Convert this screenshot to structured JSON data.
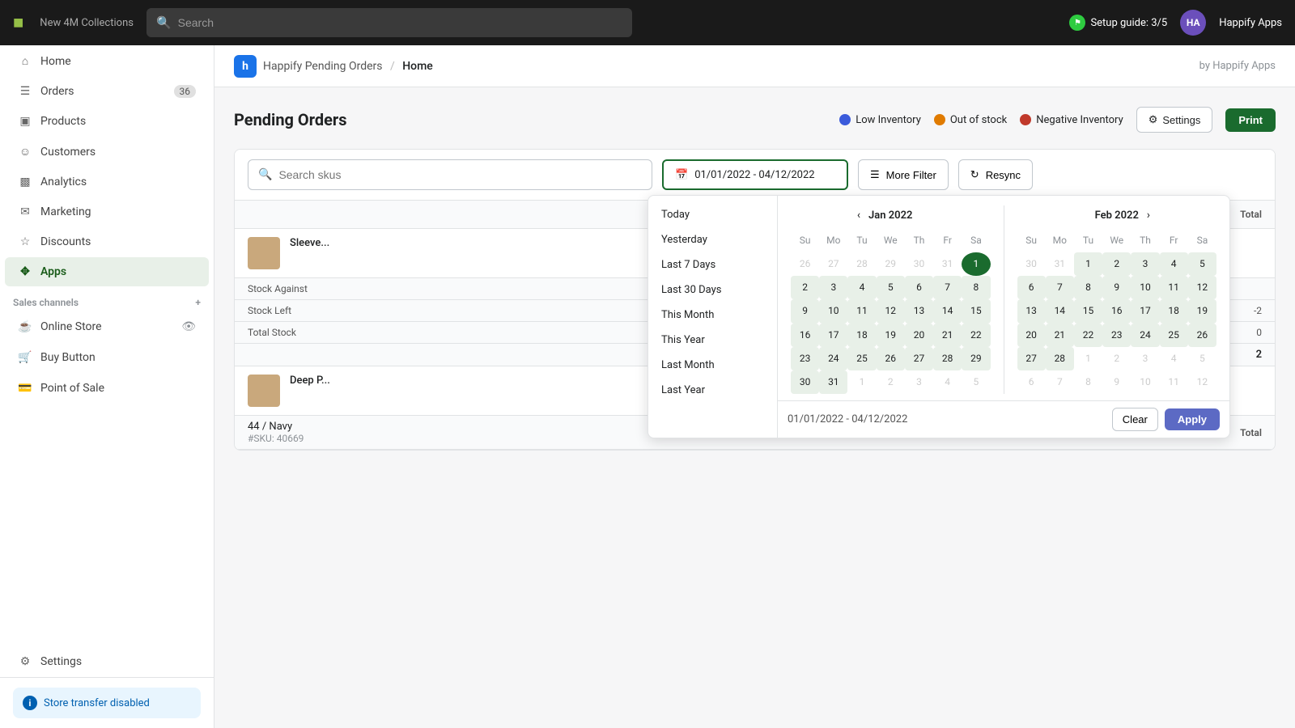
{
  "topBar": {
    "logoText": "S",
    "storeName": "New 4M Collections",
    "searchPlaceholder": "Search",
    "setupGuide": "Setup guide: 3/5",
    "userName": "Happify Apps",
    "userInitials": "HA"
  },
  "sidebar": {
    "navItems": [
      {
        "id": "home",
        "label": "Home",
        "icon": "🏠",
        "badge": null,
        "active": false
      },
      {
        "id": "orders",
        "label": "Orders",
        "icon": "📋",
        "badge": "36",
        "active": false
      },
      {
        "id": "products",
        "label": "Products",
        "icon": "📦",
        "badge": null,
        "active": false
      },
      {
        "id": "customers",
        "label": "Customers",
        "icon": "👤",
        "badge": null,
        "active": false
      },
      {
        "id": "analytics",
        "label": "Analytics",
        "icon": "📊",
        "badge": null,
        "active": false
      },
      {
        "id": "marketing",
        "label": "Marketing",
        "icon": "📣",
        "badge": null,
        "active": false
      },
      {
        "id": "discounts",
        "label": "Discounts",
        "icon": "🏷️",
        "badge": null,
        "active": false
      },
      {
        "id": "apps",
        "label": "Apps",
        "icon": "⊞",
        "badge": null,
        "active": true
      }
    ],
    "salesChannelsLabel": "Sales channels",
    "salesChannels": [
      {
        "id": "online-store",
        "label": "Online Store",
        "icon": "🏪"
      },
      {
        "id": "buy-button",
        "label": "Buy Button",
        "icon": "🛍️"
      },
      {
        "id": "point-of-sale",
        "label": "Point of Sale",
        "icon": "💳"
      }
    ],
    "settingsLabel": "Settings",
    "storeTransfer": "Store transfer disabled"
  },
  "appHeader": {
    "logoText": "h",
    "appName": "Happify Pending Orders",
    "separator": "/",
    "currentPage": "Home",
    "byLabel": "by Happify Apps"
  },
  "pageTitle": "Pending Orders",
  "legend": [
    {
      "id": "low-inventory",
      "label": "Low Inventory",
      "color": "#3b5bdb"
    },
    {
      "id": "out-of-stock",
      "label": "Out of stock",
      "color": "#e07b00"
    },
    {
      "id": "negative-inventory",
      "label": "Negative Inventory",
      "color": "#c0392b"
    }
  ],
  "buttons": {
    "settings": "Settings",
    "print": "Print",
    "moreFilter": "More Filter",
    "resync": "Resync",
    "clear": "Clear",
    "apply": "Apply"
  },
  "searchSkus": {
    "placeholder": "Search skus"
  },
  "dateRange": {
    "value": "01/01/2022 - 04/12/2022",
    "displayValue": "01/01/2022 - 04/12/2022"
  },
  "presets": [
    {
      "id": "today",
      "label": "Today"
    },
    {
      "id": "yesterday",
      "label": "Yesterday"
    },
    {
      "id": "last7days",
      "label": "Last 7 Days"
    },
    {
      "id": "last30days",
      "label": "Last 30 Days"
    },
    {
      "id": "thismonth",
      "label": "This Month"
    },
    {
      "id": "thisyear",
      "label": "This Year"
    },
    {
      "id": "lastmonth",
      "label": "Last Month"
    },
    {
      "id": "lastyear",
      "label": "Last Year"
    }
  ],
  "calendar": {
    "jan": {
      "title": "Jan 2022",
      "weekdays": [
        "Su",
        "Mo",
        "Tu",
        "We",
        "Th",
        "Fr",
        "Sa"
      ],
      "weeks": [
        [
          {
            "day": "26",
            "other": true
          },
          {
            "day": "27",
            "other": true
          },
          {
            "day": "28",
            "other": true
          },
          {
            "day": "29",
            "other": true
          },
          {
            "day": "30",
            "other": true
          },
          {
            "day": "31",
            "other": true
          },
          {
            "day": "1",
            "selected": true
          }
        ],
        [
          {
            "day": "2"
          },
          {
            "day": "3"
          },
          {
            "day": "4"
          },
          {
            "day": "5"
          },
          {
            "day": "6"
          },
          {
            "day": "7"
          },
          {
            "day": "8"
          }
        ],
        [
          {
            "day": "9"
          },
          {
            "day": "10"
          },
          {
            "day": "11"
          },
          {
            "day": "12"
          },
          {
            "day": "13"
          },
          {
            "day": "14"
          },
          {
            "day": "15"
          }
        ],
        [
          {
            "day": "16"
          },
          {
            "day": "17"
          },
          {
            "day": "18"
          },
          {
            "day": "19"
          },
          {
            "day": "20"
          },
          {
            "day": "21"
          },
          {
            "day": "22"
          }
        ],
        [
          {
            "day": "23"
          },
          {
            "day": "24"
          },
          {
            "day": "25"
          },
          {
            "day": "26"
          },
          {
            "day": "27"
          },
          {
            "day": "28"
          },
          {
            "day": "29"
          }
        ],
        [
          {
            "day": "30"
          },
          {
            "day": "31"
          },
          {
            "day": "1",
            "other": true
          },
          {
            "day": "2",
            "other": true
          },
          {
            "day": "3",
            "other": true
          },
          {
            "day": "4",
            "other": true
          },
          {
            "day": "5",
            "other": true
          }
        ]
      ]
    },
    "feb": {
      "title": "Feb 2022",
      "weekdays": [
        "Su",
        "Mo",
        "Tu",
        "We",
        "Th",
        "Fr",
        "Sa"
      ],
      "weeks": [
        [
          {
            "day": "30",
            "other": true
          },
          {
            "day": "31",
            "other": true
          },
          {
            "day": "1"
          },
          {
            "day": "2"
          },
          {
            "day": "3"
          },
          {
            "day": "4"
          },
          {
            "day": "5"
          }
        ],
        [
          {
            "day": "6"
          },
          {
            "day": "7"
          },
          {
            "day": "8"
          },
          {
            "day": "9"
          },
          {
            "day": "10"
          },
          {
            "day": "11"
          },
          {
            "day": "12"
          }
        ],
        [
          {
            "day": "13"
          },
          {
            "day": "14"
          },
          {
            "day": "15"
          },
          {
            "day": "16"
          },
          {
            "day": "17"
          },
          {
            "day": "18"
          },
          {
            "day": "19"
          }
        ],
        [
          {
            "day": "20"
          },
          {
            "day": "21"
          },
          {
            "day": "22"
          },
          {
            "day": "23"
          },
          {
            "day": "24"
          },
          {
            "day": "25"
          },
          {
            "day": "26"
          }
        ],
        [
          {
            "day": "27"
          },
          {
            "day": "28"
          },
          {
            "day": "1",
            "other": true
          },
          {
            "day": "2",
            "other": true
          },
          {
            "day": "3",
            "other": true
          },
          {
            "day": "4",
            "other": true
          },
          {
            "day": "5",
            "other": true
          }
        ],
        [
          {
            "day": "6",
            "other": true
          },
          {
            "day": "7",
            "other": true
          },
          {
            "day": "8",
            "other": true
          },
          {
            "day": "9",
            "other": true
          },
          {
            "day": "10",
            "other": true
          },
          {
            "day": "11",
            "other": true
          },
          {
            "day": "12",
            "other": true
          }
        ]
      ]
    }
  },
  "tableRows": [
    {
      "id": "row1",
      "productName": "Sleeve...",
      "hasImage": true,
      "subRows": [
        {
          "label": "Stock Against",
          "value": ""
        },
        {
          "label": "Stock Left",
          "value": "-2"
        },
        {
          "label": "Total Stock",
          "value": "0"
        }
      ],
      "total": "2",
      "totalLabel": "Total"
    },
    {
      "id": "row2",
      "productName": "Deep P...",
      "hasImage": true,
      "sku": "44 / Navy",
      "skuCode": "#SKU: 40669",
      "total": "",
      "totalLabel": "Total"
    }
  ]
}
